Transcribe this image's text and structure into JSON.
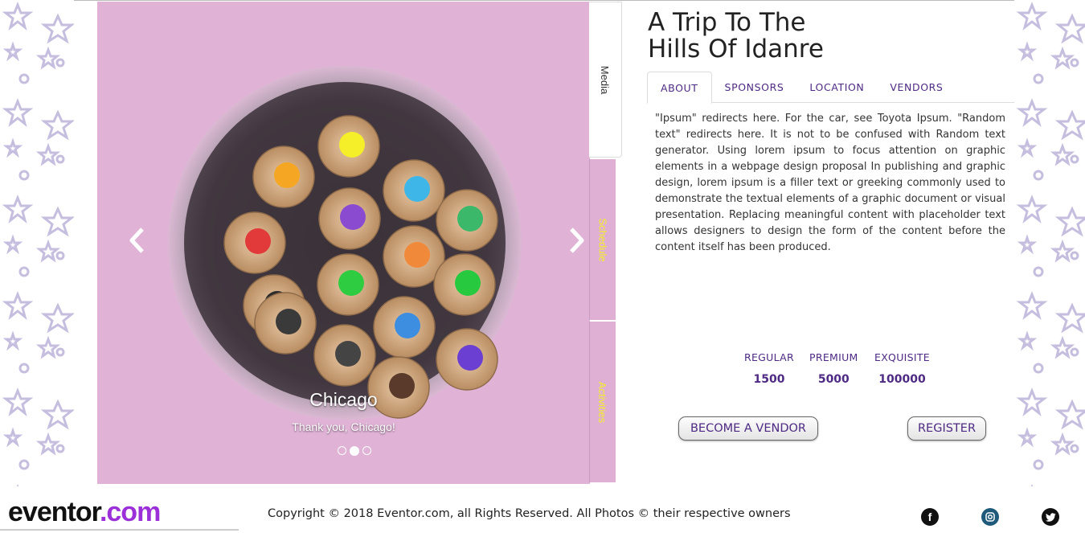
{
  "event": {
    "title_line1": "A Trip To The",
    "title_line2": "Hills Of Idanre"
  },
  "side_tabs": {
    "media": "Media",
    "schedule": "Schedule",
    "activities": "Activities"
  },
  "carousel": {
    "caption_title": "Chicago",
    "caption_subtitle": "Thank you, Chicago!",
    "slide_count": 3,
    "active_slide": 2,
    "prev_icon": "chevron-left-icon",
    "next_icon": "chevron-right-icon"
  },
  "tabs": {
    "about": "ABOUT",
    "sponsors": "SPONSORS",
    "location": "LOCATION",
    "vendors": "VENDORS",
    "active": "ABOUT"
  },
  "about_text": "\"Ipsum\" redirects here. For the car, see Toyota Ipsum. \"Random text\" redirects here. It is not to be confused with Random text generator. Using lorem ipsum to focus attention on graphic elements in a webpage design proposal In publishing and graphic design, lorem ipsum is a filler text or greeking commonly used to demonstrate the textual elements of a graphic document or visual presentation. Replacing meaningful content with placeholder text allows designers to design the form of the content before the content itself has been produced.",
  "pricing": {
    "regular_label": "REGULAR",
    "regular_value": "1500",
    "premium_label": "PREMIUM",
    "premium_value": "5000",
    "exquisite_label": "EXQUISITE",
    "exquisite_value": "100000"
  },
  "buttons": {
    "vendor": "BECOME A VENDOR",
    "register": "REGISTER"
  },
  "footer": {
    "logo_part1": "eventor",
    "logo_part2": ".com",
    "copyright": "Copyright © 2018 Eventor.com, all Rights Reserved. All Photos © their respective owners",
    "social_icons": [
      "facebook-icon",
      "instagram-icon",
      "twitter-icon"
    ]
  },
  "colors": {
    "accent": "#4e2a84",
    "tab_text_yellow": "#f2ee2a",
    "carousel_bg": "#e2b4d8",
    "logo_purple": "#9b30d9"
  }
}
